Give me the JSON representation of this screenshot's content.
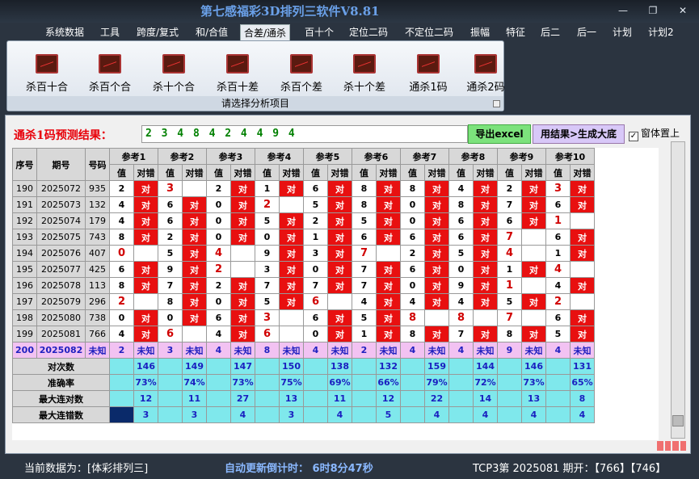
{
  "window": {
    "title": "第七感福彩3D排列三软件V8.81",
    "minimize": "—",
    "restore": "❐",
    "close": "✕"
  },
  "menu": [
    "系统数据",
    "工具",
    "跨度/复式",
    "和/合值",
    "合差/通杀",
    "百十个",
    "定位二码",
    "不定位二码",
    "振幅",
    "特征",
    "后二",
    "后一",
    "计划",
    "计划2"
  ],
  "menu_active": "合差/通杀",
  "ribbon": {
    "buttons": [
      "杀百十合",
      "杀百个合",
      "杀十个合",
      "杀百十差",
      "杀百个差",
      "杀十个差",
      "通杀1码",
      "通杀2码"
    ],
    "caption": "请选择分析项目"
  },
  "prediction": {
    "label": "通杀1码预测结果：",
    "value": "2 3 4 8 4 2 4 4 9 4",
    "excel_button": "导出excel",
    "generate_button": "用结果>生成大底",
    "topmost_label": "窗体置上",
    "topmost_checked": "✓"
  },
  "table": {
    "headers": {
      "seq": "序号",
      "period": "期号",
      "number": "号码"
    },
    "refs": [
      "参考1",
      "参考2",
      "参考3",
      "参考4",
      "参考5",
      "参考6",
      "参考7",
      "参考8",
      "参考9",
      "参考10"
    ],
    "sub_value": "值",
    "sub_result": "对错",
    "hit_label": "对",
    "rows": [
      {
        "seq": "190",
        "period": "2025072",
        "number": "935",
        "vals": [
          2,
          3,
          2,
          1,
          6,
          8,
          8,
          4,
          2,
          3
        ],
        "hits": [
          1,
          0,
          1,
          1,
          1,
          1,
          1,
          1,
          1,
          1
        ],
        "red": [
          0,
          1,
          0,
          0,
          0,
          0,
          0,
          0,
          0,
          1
        ]
      },
      {
        "seq": "191",
        "period": "2025073",
        "number": "132",
        "vals": [
          4,
          6,
          0,
          2,
          5,
          8,
          0,
          8,
          7,
          6
        ],
        "hits": [
          1,
          1,
          1,
          0,
          1,
          1,
          1,
          1,
          1,
          1
        ],
        "red": [
          0,
          0,
          0,
          1,
          0,
          0,
          0,
          0,
          0,
          0
        ]
      },
      {
        "seq": "192",
        "period": "2025074",
        "number": "179",
        "vals": [
          4,
          6,
          0,
          5,
          2,
          5,
          0,
          6,
          6,
          1
        ],
        "hits": [
          1,
          1,
          1,
          1,
          1,
          1,
          1,
          1,
          1,
          0
        ],
        "red": [
          0,
          0,
          0,
          0,
          0,
          0,
          0,
          0,
          0,
          1
        ]
      },
      {
        "seq": "193",
        "period": "2025075",
        "number": "743",
        "vals": [
          8,
          2,
          0,
          0,
          1,
          6,
          6,
          6,
          7,
          6
        ],
        "hits": [
          1,
          1,
          1,
          1,
          1,
          1,
          1,
          1,
          0,
          1
        ],
        "red": [
          0,
          0,
          0,
          0,
          0,
          0,
          0,
          0,
          1,
          0
        ]
      },
      {
        "seq": "194",
        "period": "2025076",
        "number": "407",
        "vals": [
          0,
          5,
          4,
          9,
          3,
          7,
          2,
          5,
          4,
          1
        ],
        "hits": [
          0,
          1,
          0,
          1,
          1,
          0,
          1,
          1,
          0,
          1
        ],
        "red": [
          1,
          0,
          1,
          0,
          0,
          1,
          0,
          0,
          1,
          0
        ]
      },
      {
        "seq": "195",
        "period": "2025077",
        "number": "425",
        "vals": [
          6,
          9,
          2,
          3,
          0,
          7,
          6,
          0,
          1,
          4
        ],
        "hits": [
          1,
          1,
          0,
          1,
          1,
          1,
          1,
          1,
          1,
          0
        ],
        "red": [
          0,
          0,
          1,
          0,
          0,
          0,
          0,
          0,
          0,
          1
        ]
      },
      {
        "seq": "196",
        "period": "2025078",
        "number": "113",
        "vals": [
          8,
          7,
          2,
          7,
          7,
          7,
          0,
          9,
          1,
          4
        ],
        "hits": [
          1,
          1,
          1,
          1,
          1,
          1,
          1,
          1,
          0,
          1
        ],
        "red": [
          0,
          0,
          0,
          0,
          0,
          0,
          0,
          0,
          1,
          0
        ]
      },
      {
        "seq": "197",
        "period": "2025079",
        "number": "296",
        "vals": [
          2,
          8,
          0,
          5,
          6,
          4,
          4,
          4,
          5,
          2
        ],
        "hits": [
          0,
          1,
          1,
          1,
          0,
          1,
          1,
          1,
          1,
          0
        ],
        "red": [
          1,
          0,
          0,
          0,
          1,
          0,
          0,
          0,
          0,
          1
        ]
      },
      {
        "seq": "198",
        "period": "2025080",
        "number": "738",
        "vals": [
          0,
          0,
          6,
          3,
          6,
          5,
          8,
          8,
          7,
          6
        ],
        "hits": [
          1,
          1,
          1,
          0,
          1,
          1,
          0,
          0,
          0,
          1
        ],
        "red": [
          0,
          0,
          0,
          1,
          0,
          0,
          1,
          1,
          1,
          0
        ]
      },
      {
        "seq": "199",
        "period": "2025081",
        "number": "766",
        "vals": [
          4,
          6,
          4,
          6,
          0,
          1,
          8,
          7,
          8,
          5
        ],
        "hits": [
          1,
          0,
          1,
          0,
          1,
          1,
          1,
          1,
          1,
          1
        ],
        "red": [
          0,
          1,
          0,
          1,
          0,
          0,
          0,
          0,
          0,
          0
        ]
      }
    ],
    "unknown_row": {
      "seq": "200",
      "period": "2025082",
      "number": "未知",
      "vals": [
        "2",
        "3",
        "4",
        "8",
        "4",
        "2",
        "4",
        "4",
        "9",
        "4"
      ],
      "status": "未知"
    },
    "stats": [
      {
        "label": "对次数",
        "values": [
          "146",
          "149",
          "147",
          "150",
          "138",
          "132",
          "159",
          "144",
          "146",
          "131"
        ]
      },
      {
        "label": "准确率",
        "values": [
          "73%",
          "74%",
          "73%",
          "75%",
          "69%",
          "66%",
          "79%",
          "72%",
          "73%",
          "65%"
        ]
      },
      {
        "label": "最大连对数",
        "values": [
          "12",
          "11",
          "27",
          "13",
          "11",
          "12",
          "22",
          "14",
          "13",
          "8"
        ]
      },
      {
        "label": "最大连错数",
        "values": [
          "3",
          "3",
          "4",
          "3",
          "4",
          "5",
          "4",
          "4",
          "4",
          "4"
        ]
      }
    ]
  },
  "status": {
    "current_data": "当前数据为：[体彩排列三]",
    "countdown": "自动更新倒计时：  6时8分47秒",
    "last_draw": "TCP3第  2025081 期开：【766】【746】"
  },
  "colors": {
    "hit": "#e81010",
    "stat_bg": "#7fe8ec",
    "unknown_bg": "#f2c2f2",
    "prediction_text": "#008000"
  }
}
